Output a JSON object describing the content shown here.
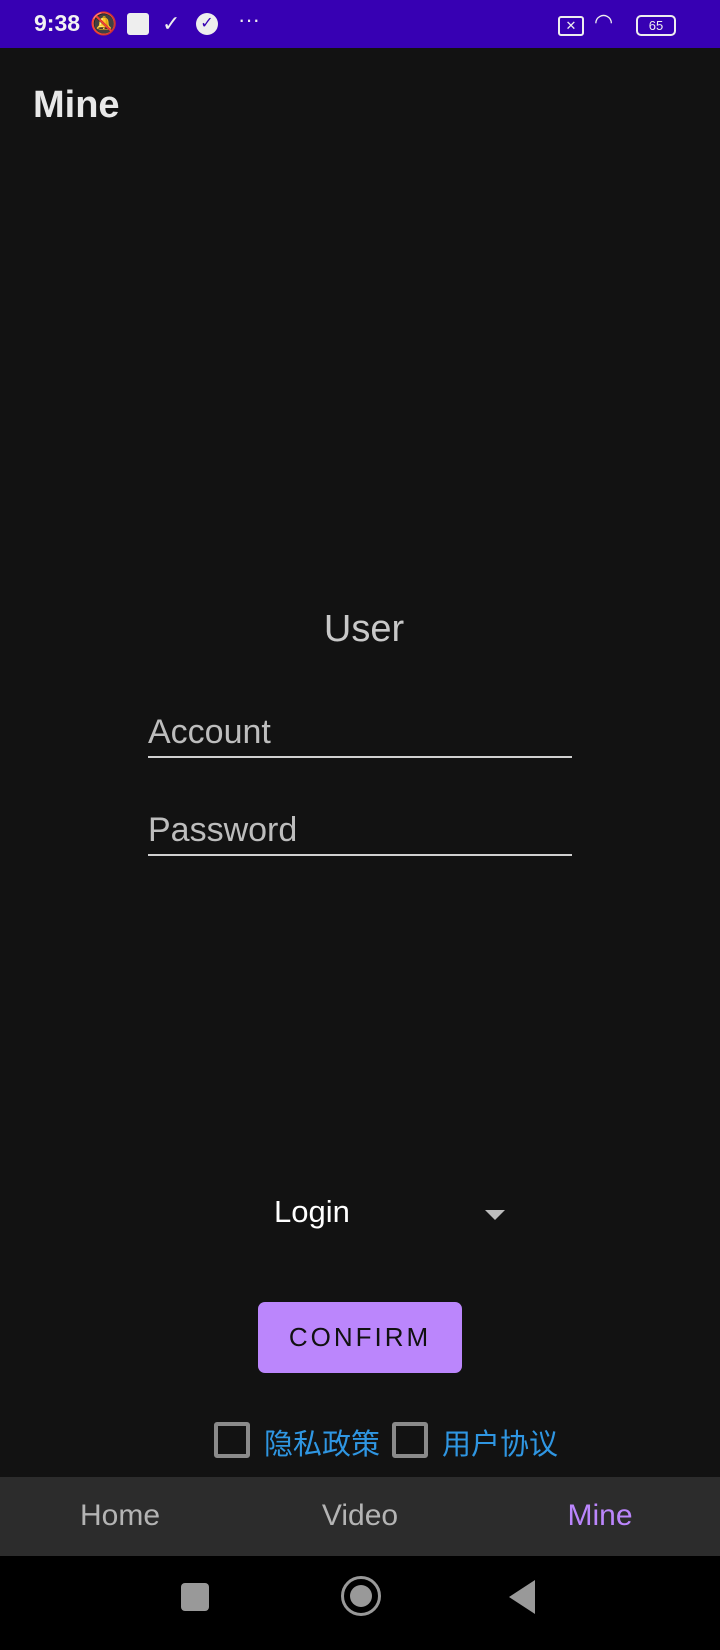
{
  "status_bar": {
    "time": "9:38",
    "battery": "65",
    "icons": [
      "bell-off-icon",
      "app-icon",
      "download-done-icon",
      "check-circle-icon",
      "more-icon",
      "sim-off-icon",
      "wifi-icon",
      "battery-icon"
    ]
  },
  "header": {
    "title": "Mine"
  },
  "form": {
    "heading": "User",
    "account_placeholder": "Account",
    "password_placeholder": "Password",
    "account_value": "",
    "password_value": ""
  },
  "spinner": {
    "selected": "Login"
  },
  "confirm_label": "CONFIRM",
  "agreements": [
    {
      "label": "隐私政策",
      "checked": false
    },
    {
      "label": "用户协议",
      "checked": false
    }
  ],
  "bottom_nav": {
    "tabs": [
      {
        "label": "Home"
      },
      {
        "label": "Video"
      },
      {
        "label": "Mine",
        "active": true
      }
    ]
  },
  "colors": {
    "status_bar": "#3700b3",
    "accent": "#bb86fc",
    "link": "#2f96e2",
    "background": "#121212"
  }
}
